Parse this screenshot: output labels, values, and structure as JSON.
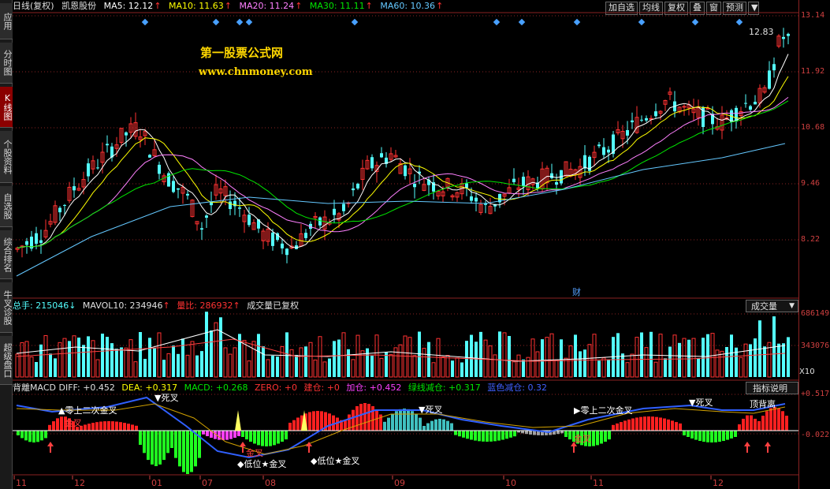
{
  "side_tabs": [
    {
      "label": "应用",
      "active": false
    },
    {
      "label": "分时图",
      "active": false
    },
    {
      "label": "K线图",
      "active": true
    },
    {
      "label": "个股资料",
      "active": false
    },
    {
      "label": "自选股",
      "active": false
    },
    {
      "label": "综合排名",
      "active": false
    },
    {
      "label": "牛叉诊股",
      "active": false
    },
    {
      "label": "超级盘口",
      "active": false
    }
  ],
  "header": {
    "period": "日线(复权)",
    "stock_name": "凯恩股份",
    "ma5": "MA5: 12.12",
    "ma10": "MA10: 11.63",
    "ma20": "MA20: 11.24",
    "ma30": "MA30: 11.11",
    "ma60": "MA60: 10.36",
    "up_arrow": "↑"
  },
  "toolbar": [
    "加自选",
    "均线",
    "复权",
    "叠",
    "窗",
    "预测"
  ],
  "toolbar_arrow": "▼",
  "watermark": {
    "title": "第一股票公式网",
    "url": "www.chnmoney.com"
  },
  "price_axis": [
    "13.14",
    "11.92",
    "10.68",
    "9.46",
    "8.22"
  ],
  "last_price": "12.83",
  "finance_marker": "财",
  "volume_panel": {
    "total_hands": "总手: 215046",
    "mavol10": "MAVOL10: 234946",
    "ratio": "量比: 286932",
    "note": "成交量已复权",
    "selector": "成交量",
    "axis": [
      "686149",
      "343076"
    ],
    "unit": "X10"
  },
  "macd_panel": {
    "name": "背離MACD",
    "diff": "DIFF: +0.452",
    "dea": "DEA: +0.317",
    "macd": "MACD: +0.268",
    "zero": "ZERO: +0",
    "jiancang": "建仓: +0",
    "jiacang": "加仓: +0.452",
    "lvxian": "绿线减仓: +0.317",
    "lanse": "蓝色减仓: 0.32",
    "help_button": "指标说明",
    "axis": [
      "+0.517",
      "-0.022"
    ],
    "labels": {
      "dead_cross": "死叉",
      "golden_cross": "金叉",
      "zero_second": "零上二次金叉",
      "low_gold": "◆低位★金叉",
      "top_div": "顶背离"
    }
  },
  "x_axis": [
    "11",
    "12",
    "01",
    "07",
    "08",
    "09",
    "10",
    "11",
    "12"
  ],
  "colors": {
    "up": "#ff3232",
    "down": "#54ffff",
    "ma5": "#ffffff",
    "ma10": "#ffff00",
    "ma20": "#ff80ff",
    "ma30": "#00e600",
    "ma60": "#64c8ff",
    "grid": "#8a2222"
  }
}
